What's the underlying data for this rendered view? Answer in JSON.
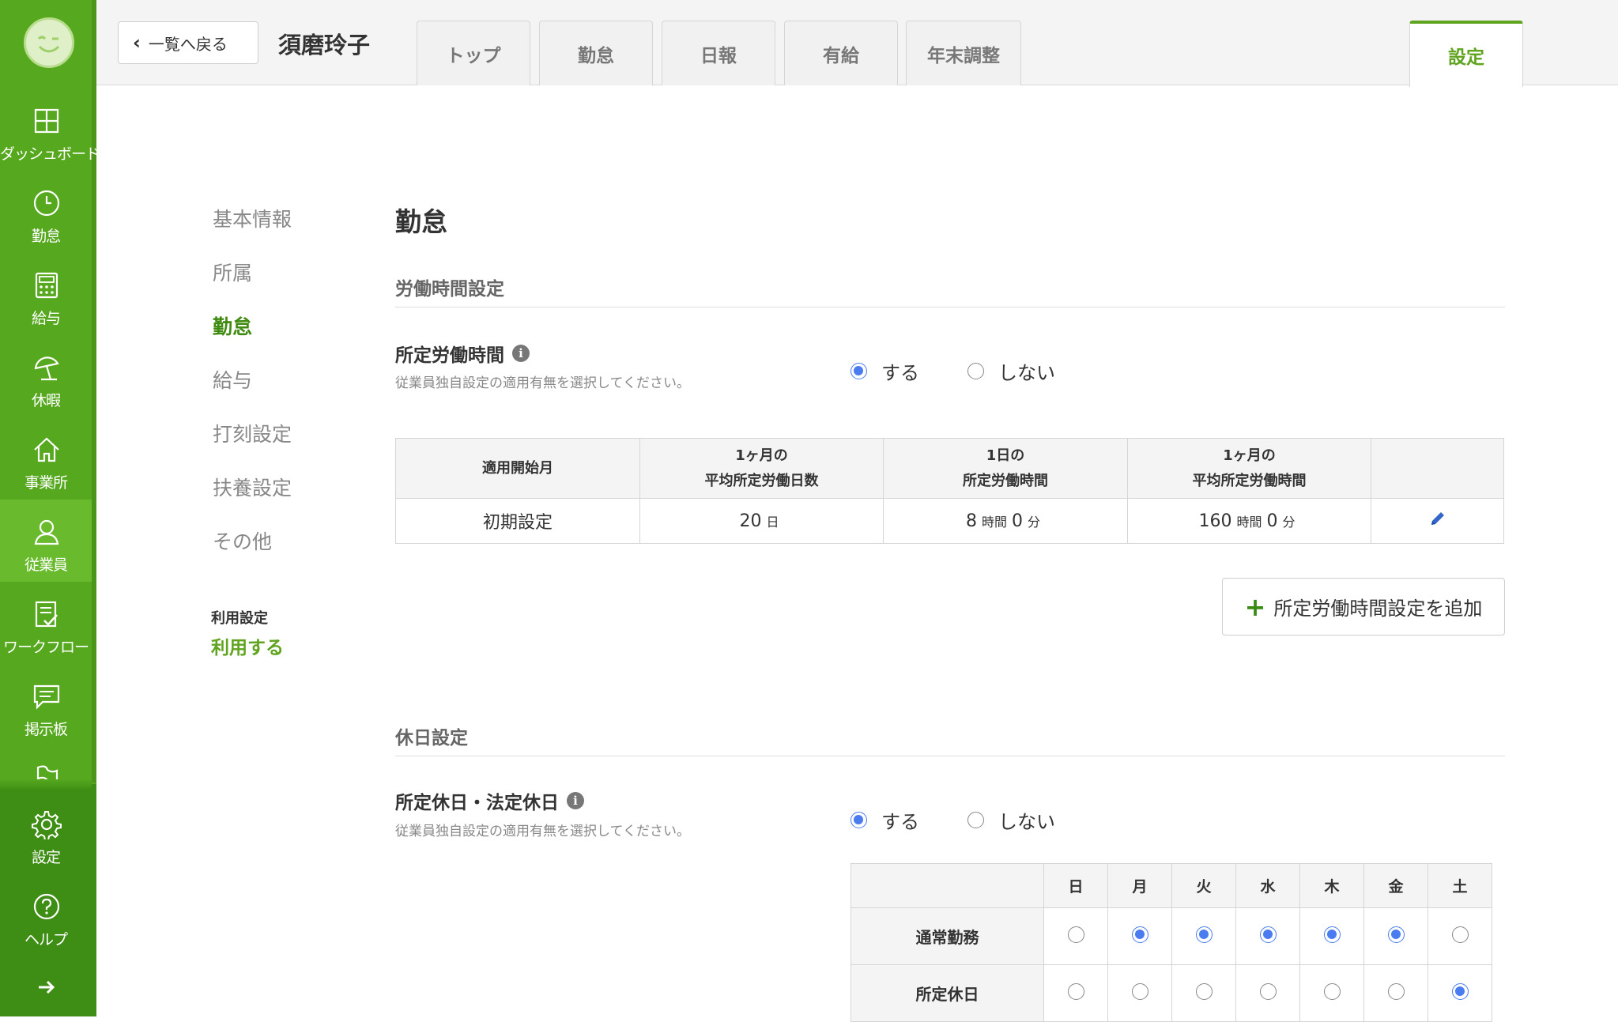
{
  "sidebar": {
    "items": [
      {
        "label": "ダッシュボード",
        "icon": "dashboard-icon"
      },
      {
        "label": "勤怠",
        "icon": "clock-icon"
      },
      {
        "label": "給与",
        "icon": "calculator-icon"
      },
      {
        "label": "休暇",
        "icon": "beach-umbrella-icon"
      },
      {
        "label": "事業所",
        "icon": "home-icon"
      },
      {
        "label": "従業員",
        "icon": "person-icon"
      },
      {
        "label": "ワークフロー",
        "icon": "checklist-icon"
      },
      {
        "label": "掲示板",
        "icon": "chat-bubble-icon"
      },
      {
        "label": "設定",
        "icon": "gear-icon"
      },
      {
        "label": "ヘルプ",
        "icon": "question-icon"
      }
    ],
    "active": "従業員"
  },
  "header": {
    "back_label": "一覧へ戻る",
    "employee_name": "須磨玲子",
    "tabs": [
      "トップ",
      "勤怠",
      "日報",
      "有給",
      "年末調整"
    ],
    "settings_tab": "設定"
  },
  "subnav": {
    "items": [
      "基本情報",
      "所属",
      "勤怠",
      "給与",
      "打刻設定",
      "扶養設定",
      "その他"
    ],
    "active": "勤怠",
    "usage_label": "利用設定",
    "usage_value": "利用する"
  },
  "main": {
    "title": "勤怠",
    "work_section": {
      "heading": "労働時間設定",
      "setting_title": "所定労働時間",
      "description": "従業員独自設定の適用有無を選択してください。",
      "options": [
        "する",
        "しない"
      ],
      "selected": "する",
      "table": {
        "headers": [
          [
            "適用開始月"
          ],
          [
            "1ヶ月の",
            "平均所定労働日数"
          ],
          [
            "1日の",
            "所定労働時間"
          ],
          [
            "1ヶ月の",
            "平均所定労働時間"
          ]
        ],
        "row": {
          "start": "初期設定",
          "days": "20",
          "days_unit": "日",
          "daily_hours": "8",
          "daily_minutes": "0",
          "monthly_hours": "160",
          "monthly_minutes": "0",
          "hour_unit": "時間",
          "minute_unit": "分"
        }
      },
      "add_button": "所定労働時間設定を追加"
    },
    "holiday_section": {
      "heading": "休日設定",
      "setting_title": "所定休日・法定休日",
      "description": "従業員独自設定の適用有無を選択してください。",
      "options": [
        "する",
        "しない"
      ],
      "selected": "する",
      "days": [
        "日",
        "月",
        "火",
        "水",
        "木",
        "金",
        "土"
      ],
      "rows": [
        {
          "label": "通常勤務",
          "checked": [
            false,
            true,
            true,
            true,
            true,
            true,
            false
          ]
        },
        {
          "label": "所定休日",
          "checked": [
            false,
            false,
            false,
            false,
            false,
            false,
            true
          ]
        }
      ]
    }
  },
  "colors": {
    "sidebar_green": "#56a81e",
    "accent_green": "#5fa31e",
    "radio_blue": "#4a7cf0",
    "edit_blue": "#3466c9"
  }
}
